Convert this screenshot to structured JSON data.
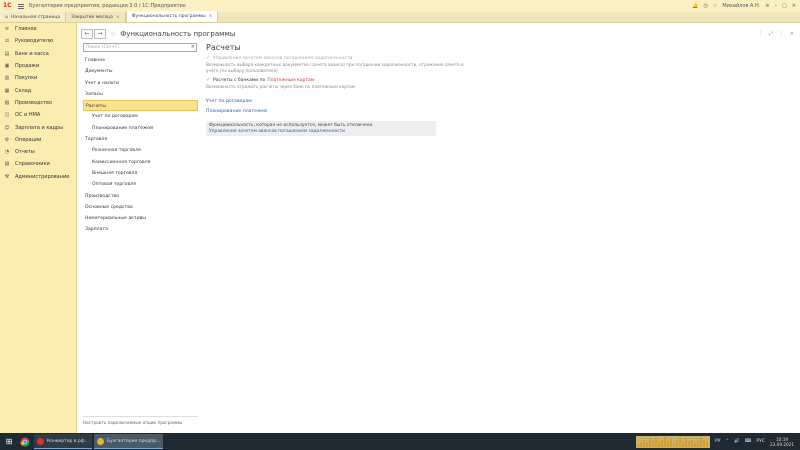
{
  "titlebar": {
    "logo": "1С",
    "app_title": "Бухгалтерия предприятия, редакция 3.0 / 1С:Предприятие",
    "user": "Михайлов А.Н.",
    "icons": [
      "bell-icon",
      "history-icon",
      "star-icon",
      "menu-icon",
      "minimize-icon",
      "maximize-icon",
      "close-icon"
    ]
  },
  "tabs": [
    {
      "label": "Начальная страница",
      "kind": "home"
    },
    {
      "label": "Закрытие месяца",
      "close": "×"
    },
    {
      "label": "Функциональность программы",
      "close": "×",
      "active": true
    }
  ],
  "leftnav": [
    {
      "icon": "≡",
      "label": "Главное"
    },
    {
      "icon": "⚖",
      "label": "Руководителю"
    },
    {
      "icon": "▤",
      "label": "Банк и касса"
    },
    {
      "icon": "▣",
      "label": "Продажи"
    },
    {
      "icon": "▥",
      "label": "Покупки"
    },
    {
      "icon": "▦",
      "label": "Склад"
    },
    {
      "icon": "▧",
      "label": "Производство"
    },
    {
      "icon": "◫",
      "label": "ОС и НМА"
    },
    {
      "icon": "☺",
      "label": "Зарплата и кадры"
    },
    {
      "icon": "⚙",
      "label": "Операции"
    },
    {
      "icon": "◔",
      "label": "Отчеты"
    },
    {
      "icon": "▨",
      "label": "Справочники"
    },
    {
      "icon": "⚒",
      "label": "Администрирование"
    }
  ],
  "toolbar": {
    "back": "←",
    "forward": "→",
    "star": "☆",
    "title": "Функциональность программы",
    "right": [
      "⋮",
      "⤢",
      "⋮",
      "×"
    ]
  },
  "search": {
    "placeholder": "Поиск (Ctrl+F)",
    "clear": "×"
  },
  "sections": [
    {
      "label": "Главное",
      "level": 0
    },
    {
      "label": "Документы",
      "level": 0
    },
    {
      "label": "Учет и налоги",
      "level": 0
    },
    {
      "label": "Запасы",
      "level": 0
    },
    {
      "label": "Расчеты",
      "level": 0,
      "active": true
    },
    {
      "label": "Учет по договорам",
      "level": 1
    },
    {
      "label": "Планирование платежей",
      "level": 1
    },
    {
      "label": "Торговля",
      "level": 0
    },
    {
      "label": "Розничная торговля",
      "level": 1
    },
    {
      "label": "Комиссионная торговля",
      "level": 1
    },
    {
      "label": "Внешняя торговля",
      "level": 1
    },
    {
      "label": "Оптовая торговля",
      "level": 1
    },
    {
      "label": "Производство",
      "level": 0
    },
    {
      "label": "Основные средства",
      "level": 0
    },
    {
      "label": "Нематериальные активы",
      "level": 0
    },
    {
      "label": "Зарплата",
      "level": 0
    }
  ],
  "panel_footer": "Настроить подключаемые опции программы",
  "main": {
    "heading": "Расчеты",
    "option1": {
      "check": "✓",
      "label": "Управление зачетом авансов погашением задолженности",
      "desc": "Возможность выбора конкретных документов (зачета аванса) при погашении задолженности, отражение зачета в учете (по выбору пользователя)"
    },
    "option2": {
      "check": "✓",
      "label_prefix": "Расчеты с банками по ",
      "label_highlight": "Платежным картам",
      "desc": "Возможность отражать расчеты через банк по платежным картам"
    },
    "link1": "Учет по договорам",
    "link2": "Планирование платежей",
    "note_text": "Функциональность, которая не используется, может быть отключена",
    "note_link": "Управление зачетом авансов погашением задолженности"
  },
  "taskbar": {
    "start": "⊞",
    "items": [
      {
        "label": "Конвертер в рф...",
        "color": "#d9322b"
      },
      {
        "label": "Бухгалтерия предпр...",
        "color": "#e4b43a",
        "active": true
      }
    ],
    "tray": [
      "РУ",
      "⌃",
      "🔊",
      "⌨"
    ],
    "lang": "РУС",
    "time": "10:19",
    "date": "23.09.2021",
    "graph": [
      3,
      5,
      7,
      4,
      8,
      6,
      9,
      5,
      7,
      10,
      6,
      8,
      4,
      7,
      9,
      5,
      8,
      6,
      7,
      4,
      6,
      9,
      7,
      5
    ]
  }
}
